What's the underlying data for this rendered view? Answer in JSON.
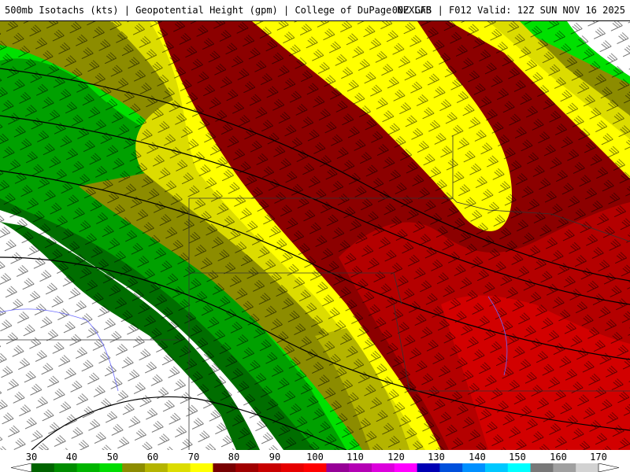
{
  "header": {
    "left": "500mb Isotachs (kts) | Geopotential Height (gpm) | College of DuPage NEXLAB",
    "right": "00Z GFS | F012 Valid: 12Z SUN NOV 16 2025"
  },
  "legend": {
    "ticks": [
      "30",
      "40",
      "50",
      "60",
      "70",
      "80",
      "90",
      "100",
      "110",
      "120",
      "130",
      "140",
      "150",
      "160",
      "170"
    ],
    "colors": [
      "#006400",
      "#008c00",
      "#00b400",
      "#00dc00",
      "#8c8c00",
      "#b4b400",
      "#dcdc00",
      "#ffff00",
      "#780000",
      "#a00000",
      "#c80000",
      "#e60000",
      "#ff0000",
      "#960096",
      "#b400b4",
      "#dc00dc",
      "#ff00ff",
      "#0000b4",
      "#0050dc",
      "#0090ff",
      "#00c8ff",
      "#00ffff",
      "#787878",
      "#a0a0a0",
      "#d2d2d2"
    ]
  },
  "map": {
    "palette": {
      "white": "#ffffff",
      "dark_green": "#006e00",
      "green": "#00a000",
      "bright_green": "#00e000",
      "olive": "#8c8c00",
      "olive_light": "#b4b400",
      "yellow": "#f0f000",
      "bright_yellow": "#ffff00",
      "dark_red": "#8c0000",
      "red": "#b40000",
      "bright_red": "#d20000"
    }
  }
}
